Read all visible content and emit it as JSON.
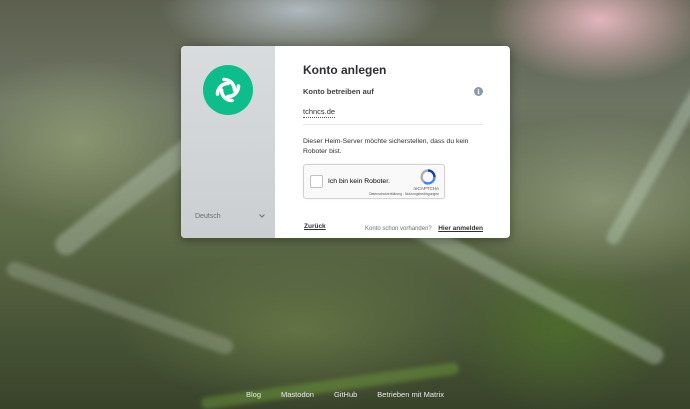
{
  "language": {
    "selected": "Deutsch"
  },
  "dialog": {
    "title": "Konto anlegen",
    "homeserver_label": "Konto betreiben auf",
    "homeserver_value": "tchncs.de",
    "captcha_description": "Dieser Heim-Server möchte sicherstellen, dass du kein Roboter bist.",
    "back_link": "Zurück",
    "login_question": "Konto schon vorhanden?",
    "login_link": "Hier anmelden"
  },
  "recaptcha": {
    "checkbox_label": "Ich bin kein Roboter.",
    "brand": "reCAPTCHA",
    "terms": "Datenschutzerklärung - Nutzungsbedingungen"
  },
  "footer_links": [
    "Blog",
    "Mastodon",
    "GitHub",
    "Betrieben mit Matrix"
  ],
  "colors": {
    "brand": "#0dbd8b",
    "text": "#2e2f32"
  }
}
